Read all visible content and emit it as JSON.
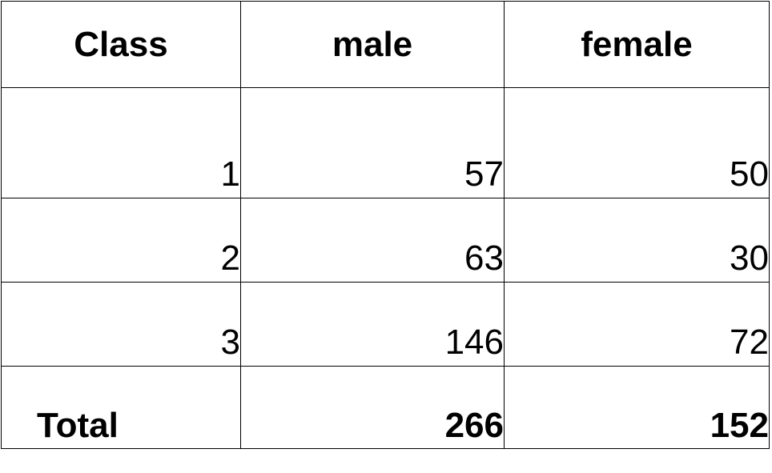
{
  "chart_data": {
    "type": "table",
    "columns": [
      "Class",
      "male",
      "female"
    ],
    "rows": [
      {
        "class": "1",
        "male": "57",
        "female": "50"
      },
      {
        "class": "2",
        "male": "63",
        "female": "30"
      },
      {
        "class": "3",
        "male": "146",
        "female": "72"
      }
    ],
    "total": {
      "label": "Total",
      "male": "266",
      "female": "152"
    }
  }
}
